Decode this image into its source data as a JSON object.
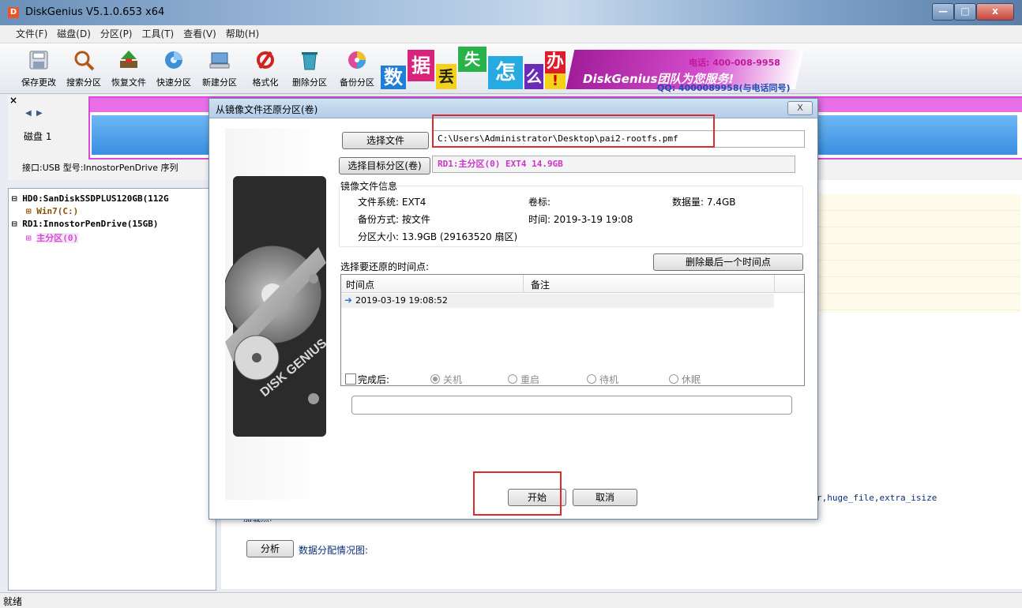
{
  "window": {
    "title": "DiskGenius V5.1.0.653 x64",
    "app_icon_glyph": "D",
    "minimize_glyph": "—",
    "maximize_glyph": "□",
    "close_glyph": "x"
  },
  "menu": [
    "文件(F)",
    "磁盘(D)",
    "分区(P)",
    "工具(T)",
    "查看(V)",
    "帮助(H)"
  ],
  "toolbar": {
    "buttons": [
      {
        "label": "保存更改",
        "icon": "save-icon"
      },
      {
        "label": "搜索分区",
        "icon": "search-icon"
      },
      {
        "label": "恢复文件",
        "icon": "recover-icon"
      },
      {
        "label": "快速分区",
        "icon": "quick-partition-icon"
      },
      {
        "label": "新建分区",
        "icon": "new-partition-icon"
      },
      {
        "label": "格式化",
        "icon": "format-icon"
      },
      {
        "label": "删除分区",
        "icon": "delete-partition-icon"
      },
      {
        "label": "备份分区",
        "icon": "backup-partition-icon"
      }
    ],
    "banner": {
      "tiles": [
        "数",
        "据",
        "丢",
        "失",
        "怎",
        "么",
        "办",
        "!"
      ],
      "brand": "DiskGenius团队为您服务!",
      "phone": "电话: 400-008-9958",
      "qq": "QQ: 4000089958(与电话同号)"
    }
  },
  "disk_panel": {
    "close_glyph": "×",
    "nav_prev": "◀",
    "nav_next": "▶",
    "disk_label": "磁盘 1",
    "interface_line": "接口:USB  型号:InnostorPenDrive  序列"
  },
  "tree": {
    "expander": "⊟",
    "sub_expander": "⊞",
    "items": [
      {
        "label": "HD0:SanDiskSSDPLUS120GB(112G"
      },
      {
        "label": "Win7(C:)"
      },
      {
        "label": "RD1:InnostorPenDrive(15GB)"
      },
      {
        "label": "主分区(0)"
      }
    ]
  },
  "right_panel": {
    "features_fragment": "r,huge_file,extra_isize",
    "mount_point_label": "加载点:",
    "analyze_button": "分析",
    "allocation_label": "数据分配情况图:"
  },
  "status_bar": {
    "text": "就绪"
  },
  "dialog": {
    "title": "从镜像文件还原分区(卷)",
    "close_glyph": "X",
    "side_logo_text": "DISK GENIUS",
    "choose_file_button": "选择文件",
    "file_path": "C:\\Users\\Administrator\\Desktop\\pai2-rootfs.pmf",
    "choose_target_button": "选择目标分区(卷)",
    "target_value": "RD1:主分区(0) EXT4 14.9GB",
    "image_info_header": "镜像文件信息",
    "file_system": "文件系统:  EXT4",
    "volume_label": "卷标:",
    "data_size": "数据量:  7.4GB",
    "backup_method": "备份方式:  按文件",
    "time": "时间:  2019-3-19 19:08",
    "partition_size": "分区大小:  13.9GB  (29163520 扇区)",
    "choose_point_label": "选择要还原的时间点:",
    "delete_last_button": "删除最后一个时间点",
    "list_headers": [
      "时间点",
      "备注"
    ],
    "list_row_icon": "➜",
    "list_rows": [
      {
        "time": "2019-03-19 19:08:52",
        "note": ""
      }
    ],
    "after_complete_label": "完成后:",
    "after_options": [
      "关机",
      "重启",
      "待机",
      "休眠"
    ],
    "selected_option": "关机",
    "start_button": "开始",
    "cancel_button": "取消"
  },
  "colors": {
    "accent_red": "#e0292b",
    "partition_magenta": "#d94ad9",
    "partition_blue": "#4aa0ea",
    "target_magenta": "#cc33cc"
  }
}
